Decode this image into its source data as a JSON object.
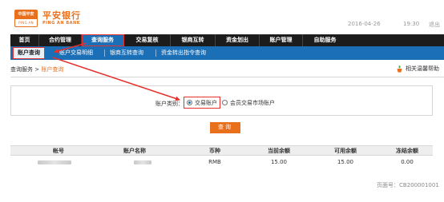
{
  "header": {
    "logo_badge_top": "中国平安",
    "logo_badge_bottom": "PING AN",
    "brand_cn": "平安银行",
    "brand_en": "PING AN BANK",
    "date": "2016-04-26",
    "time": "19:30",
    "exit_label": "退出"
  },
  "main_nav": [
    {
      "label": "首页",
      "active": false
    },
    {
      "label": "合约管理",
      "active": false
    },
    {
      "label": "查询服务",
      "active": true
    },
    {
      "label": "交易复核",
      "active": false
    },
    {
      "label": "银商互转",
      "active": false
    },
    {
      "label": "资金划出",
      "active": false
    },
    {
      "label": "账户管理",
      "active": false
    },
    {
      "label": "自助服务",
      "active": false
    }
  ],
  "sub_nav": [
    {
      "label": "账户查询",
      "active": true
    },
    {
      "label": "账户交易明细",
      "active": false
    },
    {
      "label": "银商互转查询",
      "active": false
    },
    {
      "label": "资金转出指令查询",
      "active": false
    }
  ],
  "breadcrumb": {
    "parent": "查询服务",
    "separator": ">",
    "current": "账户查询"
  },
  "help_label": "相关温馨帮助",
  "query": {
    "account_type_label": "账户类别：",
    "options": [
      {
        "label": "交易账户",
        "checked": true
      },
      {
        "label": "会员交易市场账户",
        "checked": false
      }
    ],
    "button_label": "查询"
  },
  "table": {
    "columns": [
      "帐号",
      "账户名称",
      "币种",
      "当前余额",
      "可用余额",
      "冻结余额"
    ],
    "rows": [
      {
        "account": "",
        "name": "",
        "currency": "RMB",
        "current_balance": "15.00",
        "available_balance": "15.00",
        "frozen_balance": "0.00"
      }
    ]
  },
  "page_code": "页面号：CB200001001",
  "colors": {
    "brand_orange": "#e8701c",
    "nav_blue": "#1a6fb7",
    "annotation_red": "#e5322f"
  }
}
